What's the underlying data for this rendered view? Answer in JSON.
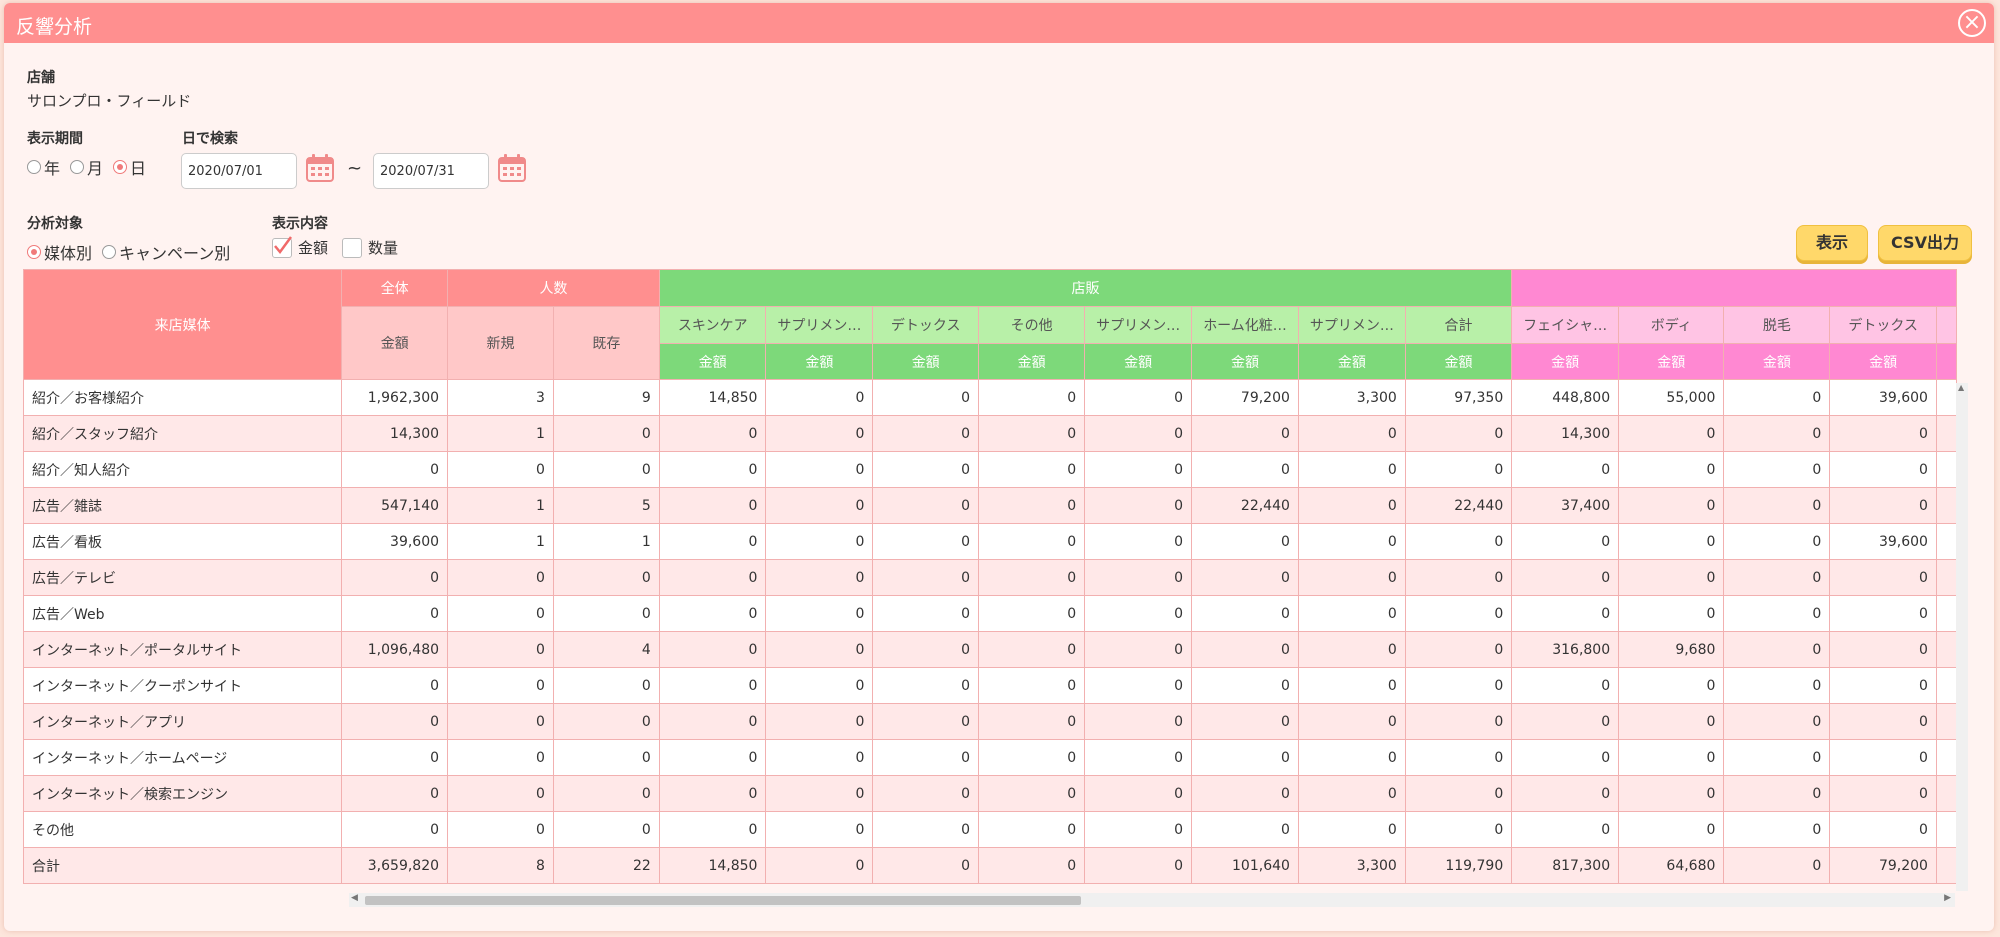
{
  "title": "反響分析",
  "store": {
    "label": "店舗",
    "value": "サロンプロ・フィールド"
  },
  "period": {
    "label": "表示期間",
    "options": [
      "年",
      "月",
      "日"
    ],
    "selected": "日"
  },
  "date_search": {
    "label": "日で検索",
    "from": "2020/07/01",
    "to": "2020/07/31",
    "separator": "~"
  },
  "target": {
    "label": "分析対象",
    "options": [
      "媒体別",
      "キャンペーン別"
    ],
    "selected": "媒体別"
  },
  "display_content": {
    "label": "表示内容",
    "options": [
      {
        "label": "金額",
        "checked": true
      },
      {
        "label": "数量",
        "checked": false
      }
    ]
  },
  "buttons": {
    "show": "表示",
    "csv": "CSV出力"
  },
  "table": {
    "row_header": "来店媒体",
    "groups": {
      "total": "全体",
      "people": "人数",
      "store_sales": "店販",
      "treatment": ""
    },
    "total_sub": "金額",
    "people_sub": [
      "新規",
      "既存"
    ],
    "store_cols": [
      "スキンケア",
      "サプリメン…",
      "デトックス",
      "その他",
      "サプリメン…",
      "ホーム化粧…",
      "サプリメン…",
      "合計"
    ],
    "treatment_cols": [
      "フェイシャ…",
      "ボディ",
      "脱毛",
      "デトックス"
    ],
    "amount_label": "金額",
    "rows": [
      {
        "name": "紹介／お客様紹介",
        "vals": [
          "1,962,300",
          "3",
          "9",
          "14,850",
          "0",
          "0",
          "0",
          "0",
          "79,200",
          "3,300",
          "97,350",
          "448,800",
          "55,000",
          "0",
          "39,600"
        ]
      },
      {
        "name": "紹介／スタッフ紹介",
        "vals": [
          "14,300",
          "1",
          "0",
          "0",
          "0",
          "0",
          "0",
          "0",
          "0",
          "0",
          "0",
          "14,300",
          "0",
          "0",
          "0"
        ]
      },
      {
        "name": "紹介／知人紹介",
        "vals": [
          "0",
          "0",
          "0",
          "0",
          "0",
          "0",
          "0",
          "0",
          "0",
          "0",
          "0",
          "0",
          "0",
          "0",
          "0"
        ]
      },
      {
        "name": "広告／雑誌",
        "vals": [
          "547,140",
          "1",
          "5",
          "0",
          "0",
          "0",
          "0",
          "0",
          "22,440",
          "0",
          "22,440",
          "37,400",
          "0",
          "0",
          "0"
        ]
      },
      {
        "name": "広告／看板",
        "vals": [
          "39,600",
          "1",
          "1",
          "0",
          "0",
          "0",
          "0",
          "0",
          "0",
          "0",
          "0",
          "0",
          "0",
          "0",
          "39,600"
        ]
      },
      {
        "name": "広告／テレビ",
        "vals": [
          "0",
          "0",
          "0",
          "0",
          "0",
          "0",
          "0",
          "0",
          "0",
          "0",
          "0",
          "0",
          "0",
          "0",
          "0"
        ]
      },
      {
        "name": "広告／Web",
        "vals": [
          "0",
          "0",
          "0",
          "0",
          "0",
          "0",
          "0",
          "0",
          "0",
          "0",
          "0",
          "0",
          "0",
          "0",
          "0"
        ]
      },
      {
        "name": "インターネット／ポータルサイト",
        "vals": [
          "1,096,480",
          "0",
          "4",
          "0",
          "0",
          "0",
          "0",
          "0",
          "0",
          "0",
          "0",
          "316,800",
          "9,680",
          "0",
          "0"
        ]
      },
      {
        "name": "インターネット／クーポンサイト",
        "vals": [
          "0",
          "0",
          "0",
          "0",
          "0",
          "0",
          "0",
          "0",
          "0",
          "0",
          "0",
          "0",
          "0",
          "0",
          "0"
        ]
      },
      {
        "name": "インターネット／アプリ",
        "vals": [
          "0",
          "0",
          "0",
          "0",
          "0",
          "0",
          "0",
          "0",
          "0",
          "0",
          "0",
          "0",
          "0",
          "0",
          "0"
        ]
      },
      {
        "name": "インターネット／ホームページ",
        "vals": [
          "0",
          "0",
          "0",
          "0",
          "0",
          "0",
          "0",
          "0",
          "0",
          "0",
          "0",
          "0",
          "0",
          "0",
          "0"
        ]
      },
      {
        "name": "インターネット／検索エンジン",
        "vals": [
          "0",
          "0",
          "0",
          "0",
          "0",
          "0",
          "0",
          "0",
          "0",
          "0",
          "0",
          "0",
          "0",
          "0",
          "0"
        ]
      },
      {
        "name": "その他",
        "vals": [
          "0",
          "0",
          "0",
          "0",
          "0",
          "0",
          "0",
          "0",
          "0",
          "0",
          "0",
          "0",
          "0",
          "0",
          "0"
        ]
      },
      {
        "name": "合計",
        "vals": [
          "3,659,820",
          "8",
          "22",
          "14,850",
          "0",
          "0",
          "0",
          "0",
          "101,640",
          "3,300",
          "119,790",
          "817,300",
          "64,680",
          "0",
          "79,200"
        ]
      }
    ]
  },
  "colors": {
    "title_bar": "#ff8f8f",
    "store_group": "#7dd97a",
    "treatment_group": "#ff88d2",
    "button": "#ffd86a"
  }
}
